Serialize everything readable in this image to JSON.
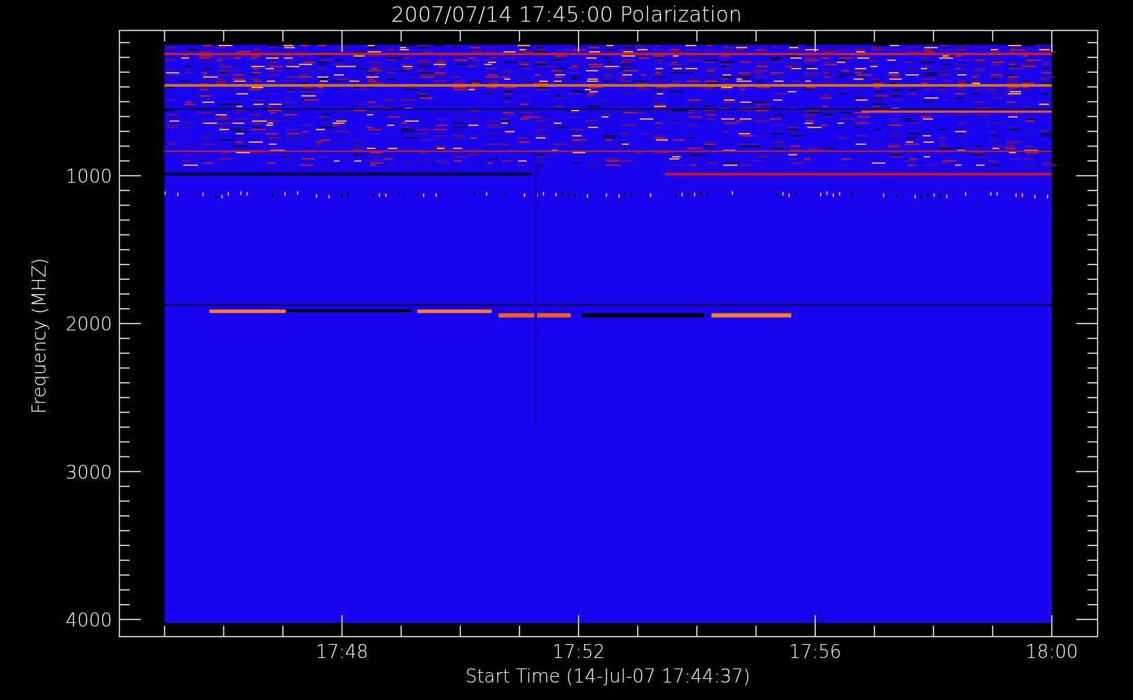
{
  "title": "2007/07/14 17:45:00 Polarization",
  "ylabel": "Frequency (MHZ)",
  "xlabel": "Start Time (14-Jul-07 17:44:37)",
  "yticks": [
    "1000",
    "2000",
    "3000",
    "4000"
  ],
  "xticks": [
    "17:48",
    "17:52",
    "17:56",
    "18:00"
  ]
}
